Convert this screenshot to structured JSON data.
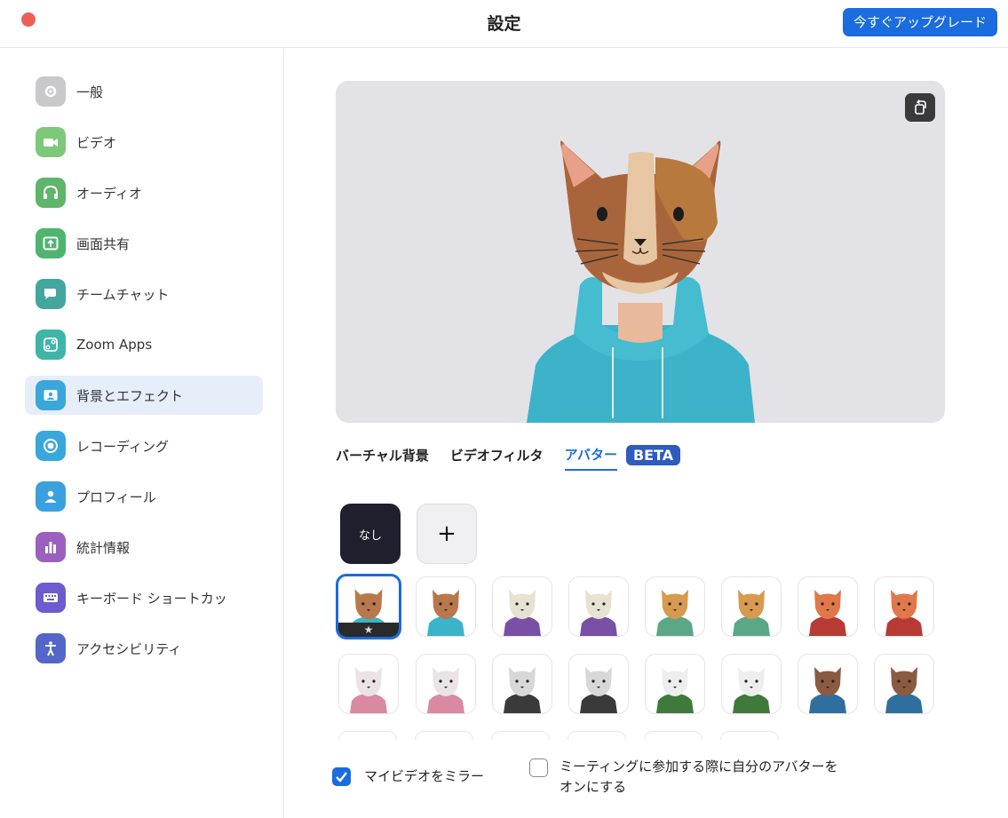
{
  "window": {
    "title": "設定",
    "upgrade_label": "今すぐアップグレード"
  },
  "sidebar": {
    "items": [
      {
        "label": "一般",
        "icon": "gear-icon",
        "color": "#c9c9cc"
      },
      {
        "label": "ビデオ",
        "icon": "video-camera-icon",
        "color": "#7ec87a"
      },
      {
        "label": "オーディオ",
        "icon": "headphones-icon",
        "color": "#5fb56a"
      },
      {
        "label": "画面共有",
        "icon": "share-screen-icon",
        "color": "#4fb46e"
      },
      {
        "label": "チームチャット",
        "icon": "chat-icon",
        "color": "#44a79e"
      },
      {
        "label": "Zoom Apps",
        "icon": "apps-icon",
        "color": "#3fb4a8"
      },
      {
        "label": "背景とエフェクト",
        "icon": "background-icon",
        "color": "#3aa7dc"
      },
      {
        "label": "レコーディング",
        "icon": "record-icon",
        "color": "#3aa7dc"
      },
      {
        "label": "プロフィール",
        "icon": "profile-icon",
        "color": "#3aa0e0"
      },
      {
        "label": "統計情報",
        "icon": "statistics-icon",
        "color": "#9b5fc0"
      },
      {
        "label": "キーボード ショートカッ",
        "icon": "keyboard-icon",
        "color": "#6c5ccf"
      },
      {
        "label": "アクセシビリティ",
        "icon": "accessibility-icon",
        "color": "#5466c8"
      }
    ],
    "active_index": 6
  },
  "tabs": [
    {
      "label": "バーチャル背景"
    },
    {
      "label": "ビデオフィルタ"
    },
    {
      "label": "アバター"
    }
  ],
  "beta_badge": "BETA",
  "tiles": {
    "none_label": "なし",
    "add_label": "+"
  },
  "avatars": [
    {
      "name": "calico-cat-avatar",
      "head": "#b9784c",
      "body": "#3bb3c9",
      "selected": true
    },
    {
      "name": "tabby-cat-avatar",
      "head": "#b9784c",
      "body": "#3bb3c9",
      "selected": false
    },
    {
      "name": "cow-avatar",
      "head": "#e8e2d2",
      "body": "#7a4fa6",
      "selected": false
    },
    {
      "name": "cow-avatar-2",
      "head": "#e8e2d2",
      "body": "#7a4fa6",
      "selected": false
    },
    {
      "name": "dog-avatar",
      "head": "#d89a4e",
      "body": "#5aa886",
      "selected": false
    },
    {
      "name": "dog-avatar-2",
      "head": "#d89a4e",
      "body": "#5aa886",
      "selected": false
    },
    {
      "name": "fox-avatar",
      "head": "#e0784a",
      "body": "#b83a35",
      "selected": false
    },
    {
      "name": "fox-avatar-2",
      "head": "#e0784a",
      "body": "#b83a35",
      "selected": false
    },
    {
      "name": "rabbit-avatar",
      "head": "#ebe4e6",
      "body": "#d98aa0",
      "selected": false
    },
    {
      "name": "rabbit-avatar-2",
      "head": "#ebe4e6",
      "body": "#d98aa0",
      "selected": false
    },
    {
      "name": "polar-bear-avatar",
      "head": "#d8d8d8",
      "body": "#3a3a3a",
      "selected": false
    },
    {
      "name": "polar-bear-avatar-2",
      "head": "#d8d8d8",
      "body": "#3a3a3a",
      "selected": false
    },
    {
      "name": "panda-avatar",
      "head": "#eeeeee",
      "body": "#3f7a3a",
      "selected": false
    },
    {
      "name": "panda-avatar-2",
      "head": "#eeeeee",
      "body": "#3f7a3a",
      "selected": false
    },
    {
      "name": "otter-avatar",
      "head": "#8a5a42",
      "body": "#2f6fa0",
      "selected": false
    },
    {
      "name": "otter-avatar-2",
      "head": "#8a5a42",
      "body": "#2f6fa0",
      "selected": false
    }
  ],
  "options": {
    "mirror_label": "マイビデオをミラー",
    "mirror_checked": true,
    "join_avatar_label_line1": "ミーティングに参加する際に自分のアバターを",
    "join_avatar_label_line2": "オンにする",
    "join_avatar_checked": false
  },
  "colors": {
    "accent": "#1a6cdf",
    "close": "#ec5f57",
    "preview_bg": "#e3e2e6"
  }
}
